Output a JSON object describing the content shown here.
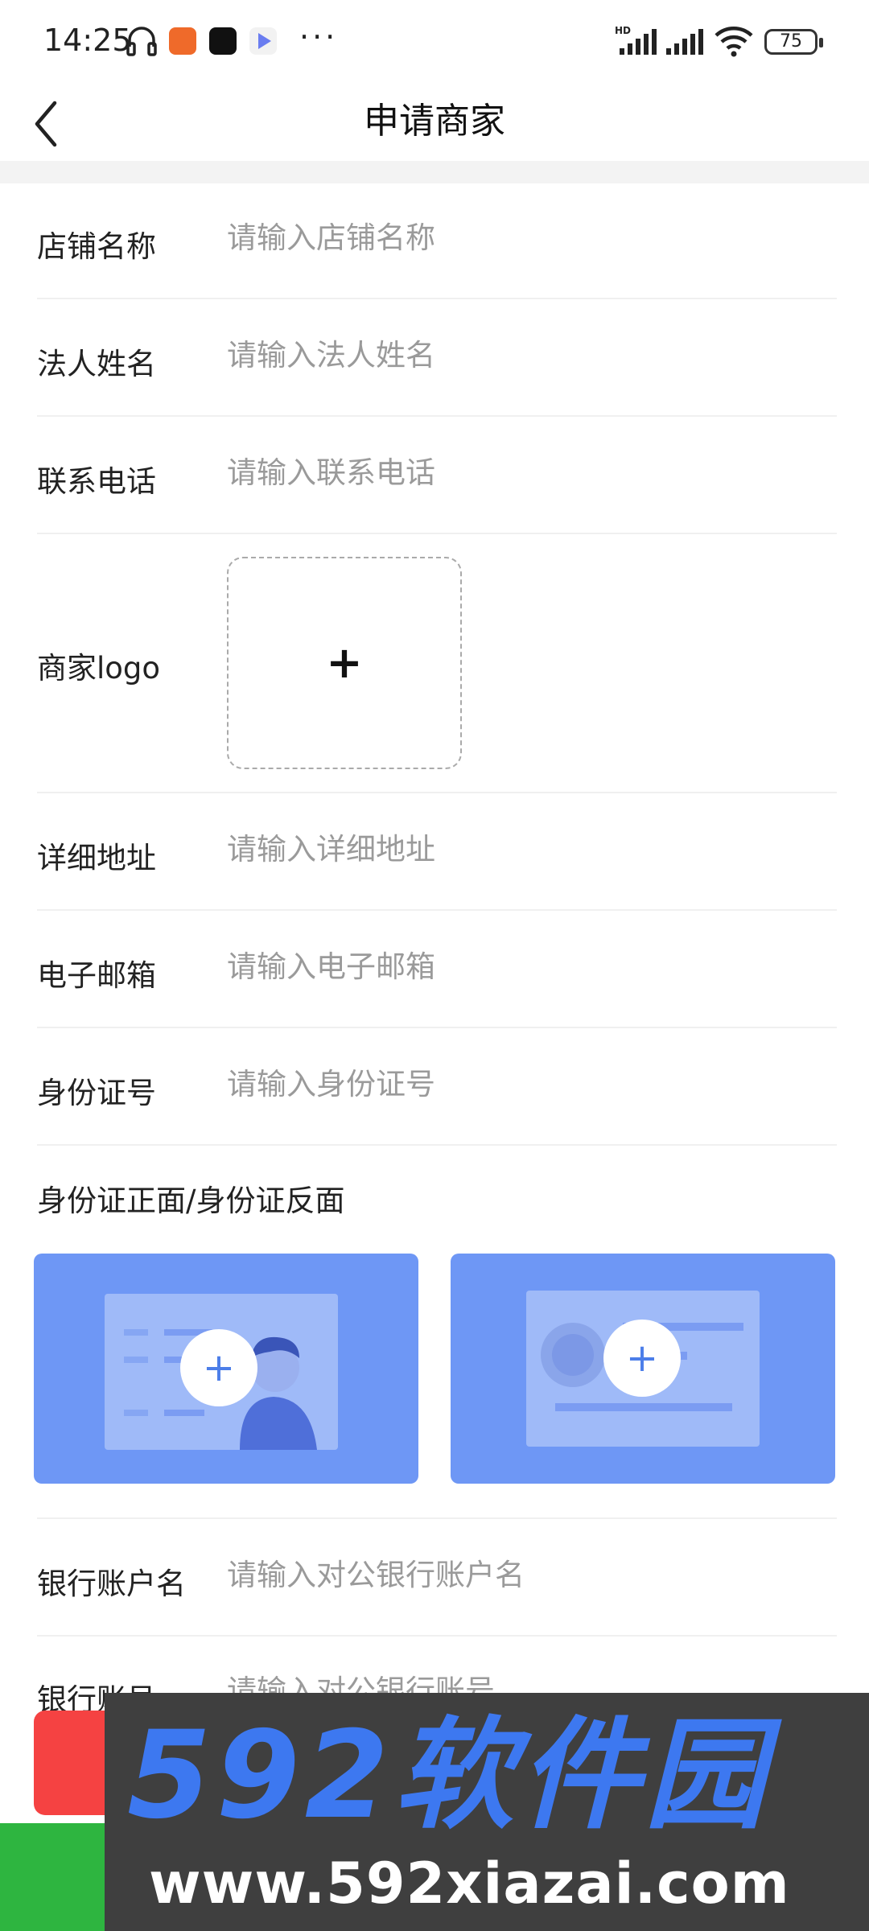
{
  "status_bar": {
    "time": "14:25",
    "battery": "75",
    "icons": [
      "headphones-icon",
      "kuaishou-app-icon",
      "tiktok-app-icon",
      "video-app-icon",
      "more-dots",
      "hd-signal-icon",
      "signal-icon",
      "wifi-icon",
      "battery-icon"
    ]
  },
  "header": {
    "title": "申请商家",
    "back_icon": "chevron-left-icon"
  },
  "form": {
    "shop_name": {
      "label": "店铺名称",
      "placeholder": "请输入店铺名称"
    },
    "legal_name": {
      "label": "法人姓名",
      "placeholder": "请输入法人姓名"
    },
    "phone": {
      "label": "联系电话",
      "placeholder": "请输入联系电话"
    },
    "logo": {
      "label": "商家logo",
      "plus": "+"
    },
    "address": {
      "label": "详细地址",
      "placeholder": "请输入详细地址"
    },
    "email": {
      "label": "电子邮箱",
      "placeholder": "请输入电子邮箱"
    },
    "id_number": {
      "label": "身份证号",
      "placeholder": "请输入身份证号"
    },
    "id_photos": {
      "label": "身份证正面/身份证反面",
      "front_plus": "+",
      "back_plus": "+"
    },
    "bank_account_name": {
      "label": "银行账户名",
      "placeholder": "请输入对公银行账户名"
    },
    "bank_account_no": {
      "label": "银行账号",
      "placeholder": "请输入对公银行账号"
    }
  },
  "watermark": {
    "brand": "592软件园",
    "url": "www.592xiazai.com"
  },
  "colors": {
    "id_card_bg": "#6e97f5",
    "id_card_inner": "#9fbaf8",
    "plus_blue": "#4c7ee9",
    "submit_red": "#f54242",
    "green": "#2eb540",
    "watermark_bg": "#3f3f3f",
    "watermark_blue": "#3d78f0"
  }
}
